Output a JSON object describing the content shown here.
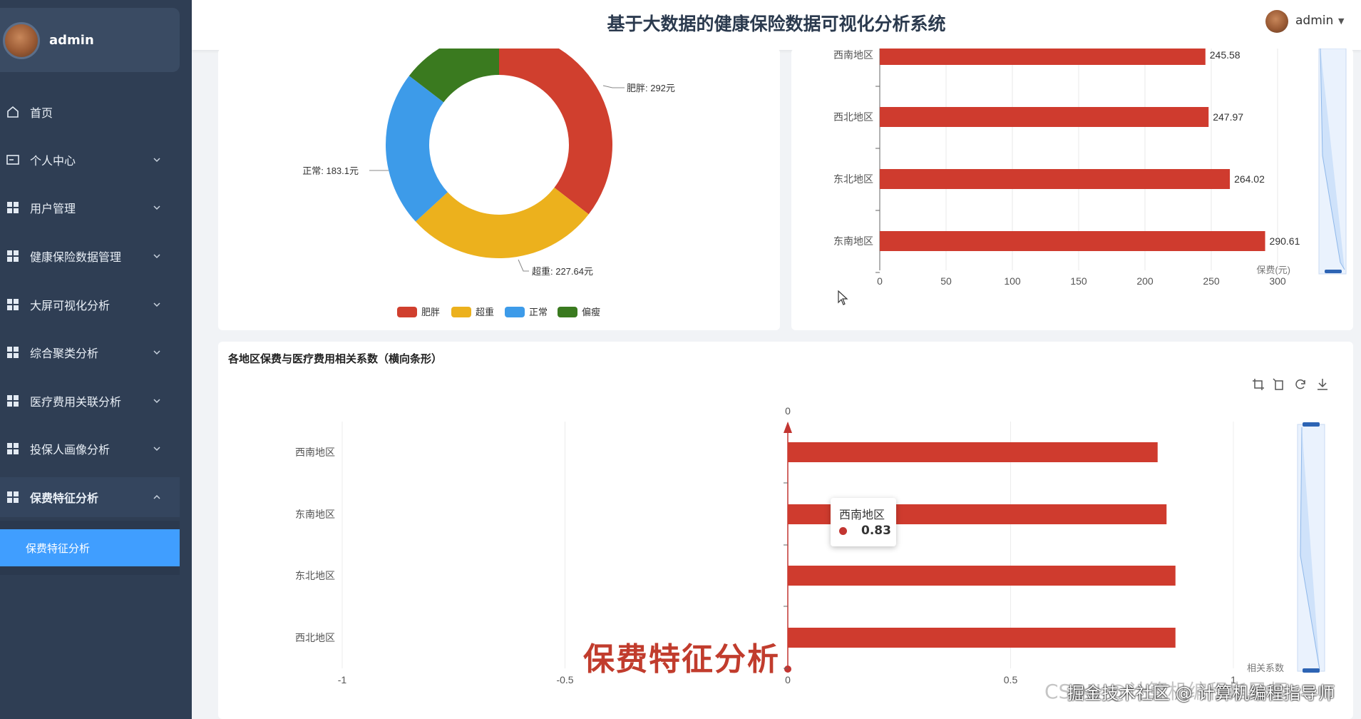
{
  "app": {
    "title": "基于大数据的健康保险数据可视化分析系统",
    "user": "admin"
  },
  "sidebar": {
    "user_name": "admin",
    "items": [
      {
        "label": "首页",
        "icon": "home-icon",
        "has_chevron": false
      },
      {
        "label": "个人中心",
        "icon": "profile-card-icon",
        "has_chevron": true
      },
      {
        "label": "用户管理",
        "icon": "grid-icon",
        "has_chevron": true
      },
      {
        "label": "健康保险数据管理",
        "icon": "grid-icon",
        "has_chevron": true
      },
      {
        "label": "大屏可视化分析",
        "icon": "grid-icon",
        "has_chevron": true
      },
      {
        "label": "综合聚类分析",
        "icon": "grid-icon",
        "has_chevron": true
      },
      {
        "label": "医疗费用关联分析",
        "icon": "grid-icon",
        "has_chevron": true
      },
      {
        "label": "投保人画像分析",
        "icon": "grid-icon",
        "has_chevron": true
      },
      {
        "label": "保费特征分析",
        "icon": "grid-icon",
        "has_chevron": true,
        "open": true
      }
    ],
    "submenu_active": "保费特征分析"
  },
  "colors": {
    "sidebar_bg": "#2f3e54",
    "active_blue": "#409eff",
    "red": "#c23531",
    "yellow": "#e6b422",
    "blue": "#3b9ae8",
    "green": "#3a7a1f"
  },
  "chart_data": [
    {
      "type": "pie",
      "variant": "donut",
      "categories": [
        "肥胖",
        "超重",
        "正常",
        "偏瘦"
      ],
      "values": [
        292,
        227.64,
        183.1,
        120
      ],
      "labels": [
        "肥胖: 292元",
        "超重: 227.64元",
        "正常: 183.1元"
      ],
      "colors": [
        "#d03f2e",
        "#ecb11d",
        "#3d9be9",
        "#3a7a1f"
      ],
      "legend": [
        "肥胖",
        "超重",
        "正常",
        "偏瘦"
      ],
      "legend_position": "bottom"
    },
    {
      "type": "bar",
      "orientation": "horizontal",
      "categories": [
        "西南地区",
        "西北地区",
        "东北地区",
        "东南地区"
      ],
      "values": [
        245.58,
        247.97,
        264.02,
        290.61
      ],
      "value_labels": [
        "245.58",
        "247.97",
        "264.02",
        "290.61"
      ],
      "xlabel": "保费(元)",
      "x_ticks": [
        "0",
        "50",
        "100",
        "150",
        "200",
        "250",
        "300"
      ],
      "xlim": [
        0,
        300
      ],
      "grid": true,
      "datazoom": "right"
    },
    {
      "type": "bar",
      "orientation": "horizontal",
      "title": "各地区保费与医疗费用相关系数（横向条形）",
      "categories": [
        "西南地区",
        "东南地区",
        "东北地区",
        "西北地区"
      ],
      "values": [
        0.83,
        0.85,
        0.87,
        0.87
      ],
      "xlabel": "相关系数",
      "x_ticks": [
        "-1",
        "-0.5",
        "0",
        "0.5",
        "1"
      ],
      "top_axis_label": "0",
      "xlim": [
        -1,
        1
      ],
      "grid": true,
      "datazoom": "right",
      "tooltip": {
        "category": "西南地区",
        "value": "0.83"
      }
    }
  ],
  "overlay": {
    "caption": "保费特征分析",
    "watermark": "CSDN @计算机编程指导师",
    "watermark_overlay": "掘金技术社区 @ 计算机编程指导师"
  }
}
